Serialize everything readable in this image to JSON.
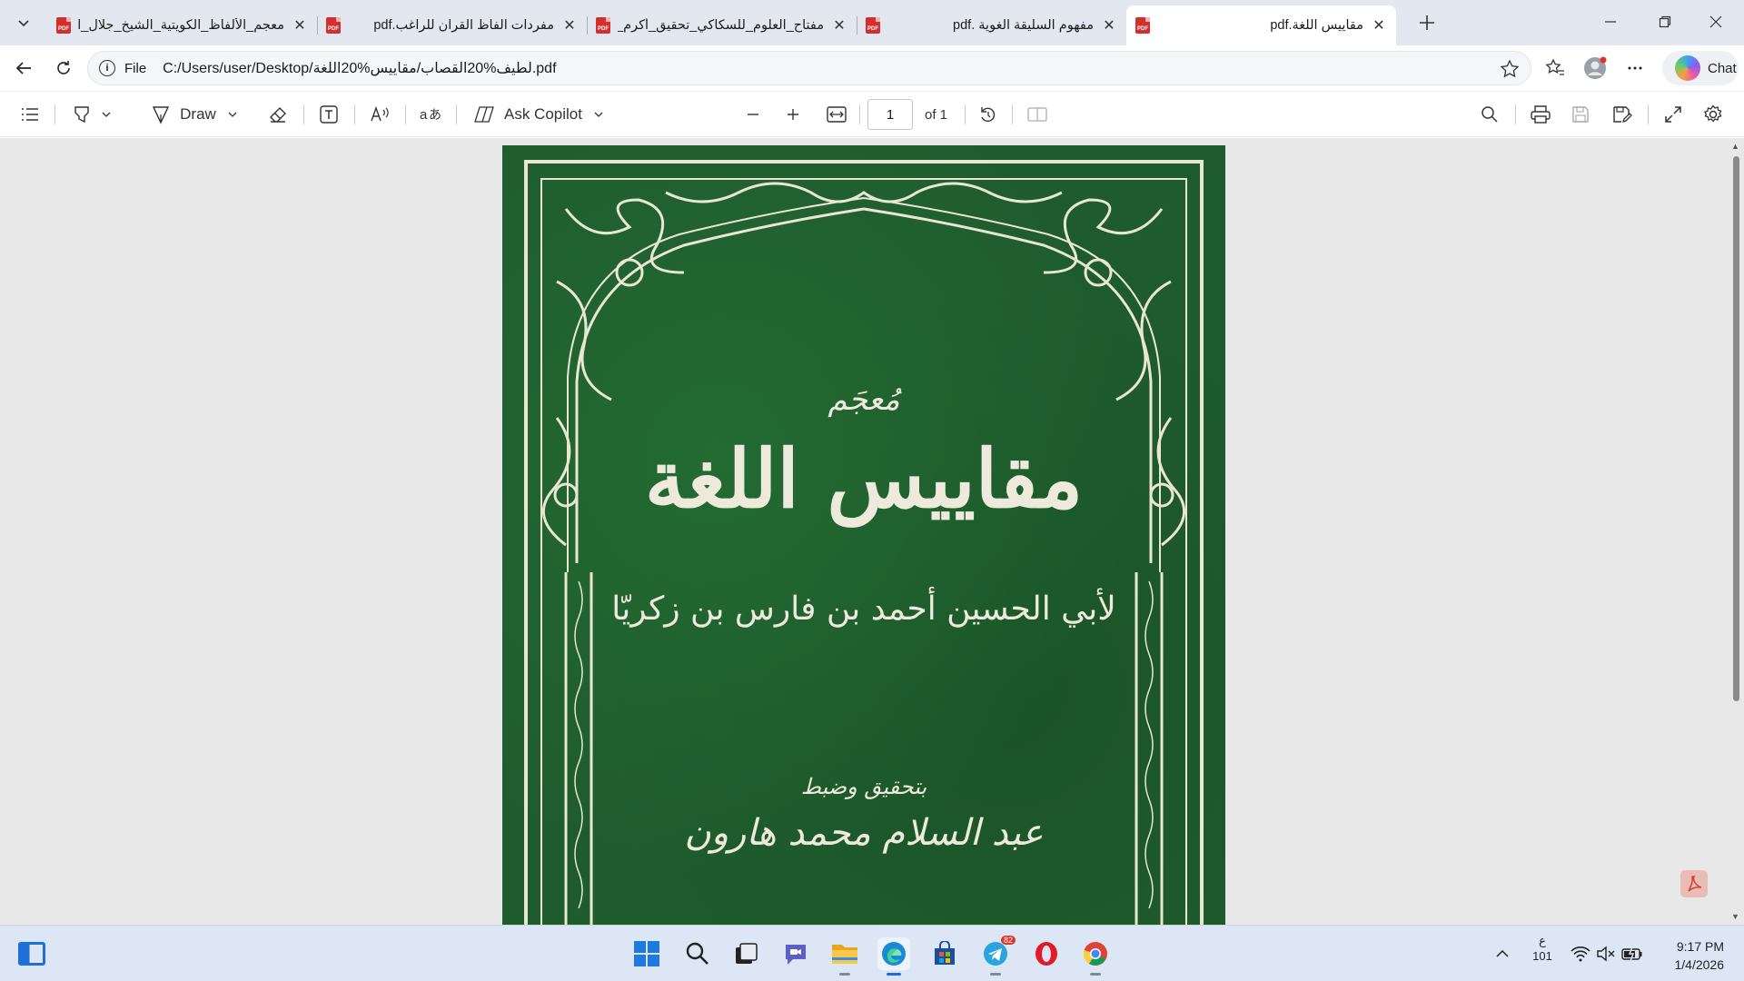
{
  "browser": {
    "tabs": [
      {
        "title": "معجم_الألفاظ_الكويتية_الشيخ_جلال_ال",
        "active": false
      },
      {
        "title": "مفردات الفاظ القران للراغب.pdf",
        "active": false
      },
      {
        "title": "مفتاح_العلوم_للسكاكي_تحقيق_أكرم_ع",
        "active": false
      },
      {
        "title": "مفهوم السليقة الغوية .pdf",
        "active": false
      },
      {
        "title": "مقاييس اللغة.pdf",
        "active": true
      }
    ],
    "address": {
      "scheme": "File",
      "url": "C:/Users/user/Desktop/لطيف%20القصاب/مقاييس%20اللغة.pdf"
    },
    "chat_label": "Chat"
  },
  "pdf_toolbar": {
    "draw_label": "Draw",
    "ask_copilot_label": "Ask Copilot",
    "page_current": "1",
    "page_total": "of 1"
  },
  "document": {
    "cover": {
      "muajam": "مُعجَم",
      "title": "مقاييس اللغة",
      "author": "لأبي الحسين أحمد بن فارس بن زكريّا",
      "tahqiq": "بتحقيق وضبط",
      "editor": "عبد السلام محمد هارون"
    },
    "colors": {
      "cover_green": "#1f5c2d",
      "cover_ink": "#eeeadb"
    }
  },
  "taskbar": {
    "icons": [
      "widgets-icon",
      "start-icon",
      "search-icon",
      "task-view-icon",
      "chat-icon",
      "file-explorer-icon",
      "edge-icon",
      "store-icon",
      "telegram-icon",
      "opera-icon",
      "chrome-icon"
    ],
    "telegram_badge": "82",
    "input_indicator_top": "ع",
    "input_indicator_bottom": "101",
    "time": "9:17 PM",
    "date": "1/4/2026"
  }
}
